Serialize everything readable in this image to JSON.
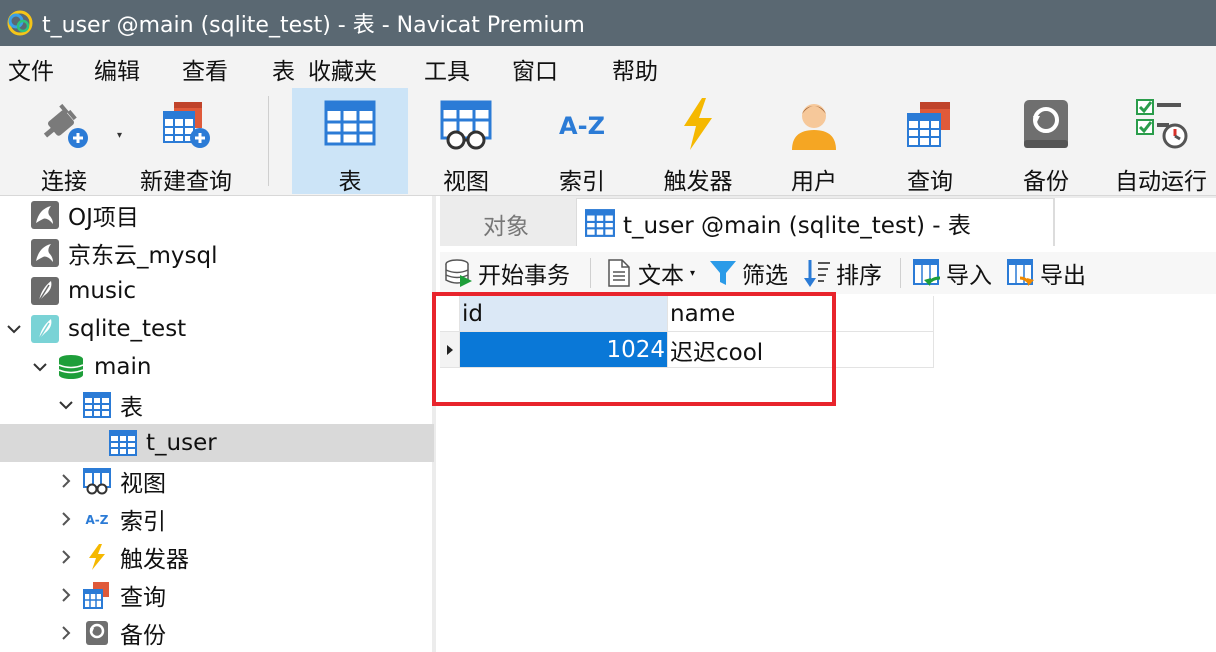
{
  "window": {
    "title": "t_user @main (sqlite_test) - 表 - Navicat Premium",
    "app_icon": "navicat-logo-icon"
  },
  "menu": {
    "items": [
      "文件",
      "编辑",
      "查看",
      "表",
      "收藏夹",
      "工具",
      "窗口",
      "帮助"
    ]
  },
  "toolbar": {
    "connect": "连接",
    "new_query": "新建查询",
    "table": "表",
    "view": "视图",
    "index": "索引",
    "trigger": "触发器",
    "user": "用户",
    "query": "查询",
    "backup": "备份",
    "automation": "自动运行",
    "active": "表"
  },
  "sidebar": {
    "nodes": [
      {
        "label": "OJ项目",
        "icon": "mysql-dolphin-icon"
      },
      {
        "label": "京东云_mysql",
        "icon": "mysql-dolphin-icon"
      },
      {
        "label": "music",
        "icon": "sqlite-feather-icon"
      },
      {
        "label": "sqlite_test",
        "icon": "sqlite-feather-icon",
        "expanded": true
      },
      {
        "label": "main",
        "icon": "database-icon",
        "expanded": true
      },
      {
        "label": "表",
        "icon": "table-icon",
        "expanded": true
      },
      {
        "label": "t_user",
        "icon": "table-icon",
        "selected": true
      },
      {
        "label": "视图",
        "icon": "view-icon"
      },
      {
        "label": "索引",
        "icon": "index-icon"
      },
      {
        "label": "触发器",
        "icon": "trigger-icon"
      },
      {
        "label": "查询",
        "icon": "query-icon"
      },
      {
        "label": "备份",
        "icon": "backup-icon"
      }
    ]
  },
  "tabs": {
    "objects": "对象",
    "active": "t_user @main (sqlite_test) - 表"
  },
  "subtoolbar": {
    "begin_transaction": "开始事务",
    "text": "文本",
    "filter": "筛选",
    "sort": "排序",
    "import": "导入",
    "export": "导出"
  },
  "grid": {
    "columns": [
      "id",
      "name"
    ],
    "rows": [
      {
        "id": "1024",
        "name": "迟迟cool"
      }
    ]
  },
  "colors": {
    "title_bar": "#5a6872",
    "selection_blue": "#0a78d7",
    "active_tool": "#cce4f7",
    "highlight_red": "#e8242c"
  }
}
